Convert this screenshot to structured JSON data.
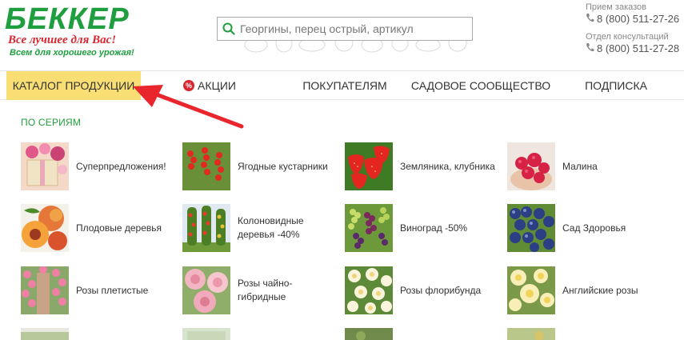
{
  "header": {
    "logo_text": "БЕККЕР",
    "slogan_main": "Все лучшее для Вас!",
    "slogan_sub": "Всем для хорошего урожая!",
    "search_placeholder": "Георгины, перец острый, артикул",
    "contacts": [
      {
        "label": "Прием заказов",
        "phone": "8 (800) 511-27-26"
      },
      {
        "label": "Отдел консультаций",
        "phone": "8 (800) 511-27-28"
      }
    ]
  },
  "colors": {
    "brand_green": "#1f9e3f",
    "brand_red": "#d8262e",
    "nav_active_bg": "#f9df73"
  },
  "nav": {
    "catalog": "КАТАЛОГ ПРОДУКЦИИ",
    "sale_badge": "%",
    "sale": "АКЦИИ",
    "buyers": "ПОКУПАТЕЛЯМ",
    "community": "САДОВОЕ СООБЩЕСТВО",
    "subscribe": "ПОДПИСКА"
  },
  "section": {
    "title": "ПО СЕРИЯМ",
    "items": [
      {
        "label": "Суперпредложения!",
        "icon": "gift-flowers"
      },
      {
        "label": "Ягодные кустарники",
        "icon": "red-berries"
      },
      {
        "label": "Земляника, клубника",
        "icon": "strawberry"
      },
      {
        "label": "Малина",
        "icon": "raspberry"
      },
      {
        "label": "Плодовые деревья",
        "icon": "peach"
      },
      {
        "label": "Колоновидные деревья -40%",
        "icon": "columnar-trees"
      },
      {
        "label": "Виноград -50%",
        "icon": "grapes"
      },
      {
        "label": "Сад Здоровья",
        "icon": "blueberry"
      },
      {
        "label": "Розы плетистые",
        "icon": "climbing-rose"
      },
      {
        "label": "Розы чайно-гибридные",
        "icon": "pink-rose"
      },
      {
        "label": "Розы флорибунда",
        "icon": "white-rose"
      },
      {
        "label": "Английские розы",
        "icon": "yellow-rose"
      }
    ]
  }
}
